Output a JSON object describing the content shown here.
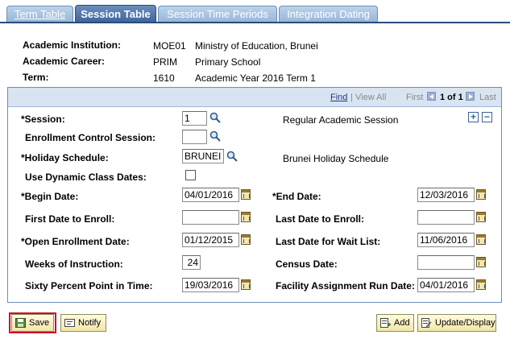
{
  "tabs": [
    {
      "label": "Term Table",
      "active": false
    },
    {
      "label": "Session Table",
      "active": true
    },
    {
      "label": "Session Time Periods",
      "active": false
    },
    {
      "label": "Integration Dating",
      "active": false
    }
  ],
  "header": {
    "institution_label": "Academic Institution:",
    "institution_code": "MOE01",
    "institution_name": "Ministry of Education, Brunei",
    "career_label": "Academic Career:",
    "career_code": "PRIM",
    "career_name": "Primary School",
    "term_label": "Term:",
    "term_code": "1610",
    "term_name": "Academic Year 2016 Term 1"
  },
  "nav": {
    "find": "Find",
    "sep": "|",
    "view_all": "View All",
    "first": "First",
    "count": "1 of 1",
    "last": "Last"
  },
  "fields": {
    "session_label": "*Session:",
    "session_value": "1",
    "session_desc": "Regular Academic Session",
    "enroll_ctrl_label": "Enrollment Control Session:",
    "enroll_ctrl_value": "",
    "holiday_label": "*Holiday Schedule:",
    "holiday_value": "BRUNEI",
    "holiday_desc": "Brunei Holiday Schedule",
    "dynamic_label": "Use Dynamic Class Dates:",
    "dynamic_checked": false,
    "begin_label": "*Begin Date:",
    "begin_value": "04/01/2016",
    "end_label": "*End Date:",
    "end_value": "12/03/2016",
    "first_enroll_label": "First Date to Enroll:",
    "first_enroll_value": "",
    "last_enroll_label": "Last Date to Enroll:",
    "last_enroll_value": "",
    "open_enroll_label": "*Open Enrollment Date:",
    "open_enroll_value": "01/12/2015",
    "last_wait_label": "Last Date for Wait List:",
    "last_wait_value": "11/06/2016",
    "weeks_label": "Weeks of Instruction:",
    "weeks_value": "24",
    "census_label": "Census Date:",
    "census_value": "",
    "sixty_label": "Sixty Percent Point in Time:",
    "sixty_value": "19/03/2016",
    "facility_label": "Facility Assignment Run Date:",
    "facility_value": "04/01/2016"
  },
  "buttons": {
    "save": "Save",
    "notify": "Notify",
    "add": "Add",
    "update": "Update/Display"
  },
  "colors": {
    "tab_active": "#3a6399",
    "tab_inactive": "#a9c4e2",
    "highlight_border": "#c8102e"
  }
}
